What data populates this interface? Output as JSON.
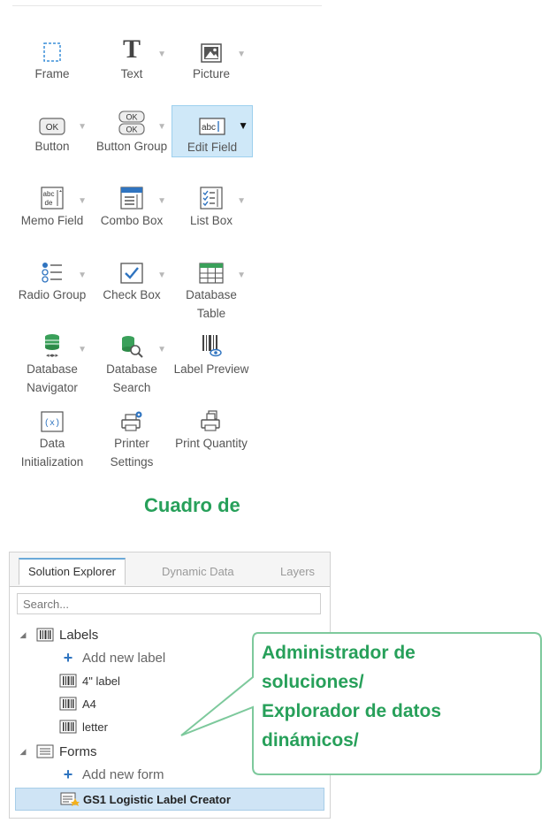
{
  "toolbox": {
    "tools": [
      {
        "label": "Frame",
        "icon": "frame-icon"
      },
      {
        "label": "Text",
        "icon": "text-icon"
      },
      {
        "label": "Picture",
        "icon": "picture-icon"
      },
      {
        "label": "Button",
        "icon": "button-icon"
      },
      {
        "label": "Button Group",
        "icon": "button-group-icon"
      },
      {
        "label": "Edit Field",
        "icon": "edit-field-icon"
      },
      {
        "label": "Memo Field",
        "icon": "memo-field-icon"
      },
      {
        "label": "Combo Box",
        "icon": "combo-box-icon"
      },
      {
        "label": "List Box",
        "icon": "list-box-icon"
      },
      {
        "label": "Radio Group",
        "icon": "radio-group-icon"
      },
      {
        "label": "Check Box",
        "icon": "check-box-icon"
      },
      {
        "label": "Database Table",
        "icon": "database-table-icon"
      },
      {
        "label": "Database Navigator",
        "icon": "database-navigator-icon"
      },
      {
        "label": "Database Search",
        "icon": "database-search-icon"
      },
      {
        "label": "Label Preview",
        "icon": "label-preview-icon"
      },
      {
        "label": "Data Initialization",
        "icon": "data-initialization-icon"
      },
      {
        "label": "Printer Settings",
        "icon": "printer-settings-icon"
      },
      {
        "label": "Print Quantity",
        "icon": "print-quantity-icon"
      }
    ],
    "caption": "Cuadro de",
    "dropdown_glyph": "▼"
  },
  "explorer": {
    "tabs": [
      "Solution Explorer",
      "Dynamic Data",
      "Layers"
    ],
    "active_tab": "Solution Explorer",
    "search_placeholder": "Search...",
    "tree": {
      "labels_group": "Labels",
      "add_label": "Add new label",
      "label_items": [
        "4\" label",
        "A4",
        "letter"
      ],
      "forms_group": "Forms",
      "add_form": "Add new form",
      "form_items": [
        "GS1 Logistic Label Creator"
      ]
    }
  },
  "callout": {
    "lines": [
      "Administrador de",
      "soluciones/",
      "Explorador de datos",
      "dinámicos/"
    ]
  },
  "colors": {
    "accent_green": "#27a05a",
    "selection_blue": "#cfe8f8",
    "add_plus": "#2f74c0"
  }
}
